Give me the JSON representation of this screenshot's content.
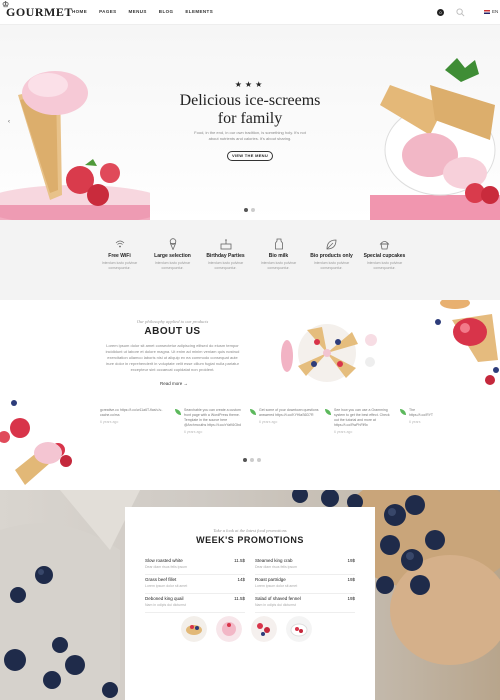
{
  "nav": {
    "logo": "GOURMET",
    "menu": [
      "HOME",
      "PAGES",
      "MENUS",
      "BLOG",
      "ELEMENTS"
    ],
    "cart_count": "0",
    "lang": "EN"
  },
  "hero": {
    "stars": "★★★",
    "title_line1": "Delicious ice-screems",
    "title_line2": "for family",
    "desc": "Food, in the end, in our own tradition, is something holy. It's not about nutrients and calories. It's about sharing.",
    "button": "VIEW THE MENU"
  },
  "features": [
    {
      "title": "Free WiFi",
      "icon": "wifi-icon",
      "desc": "Interdum iusto pulvinar consequuntur."
    },
    {
      "title": "Large selection",
      "icon": "ice-cream-icon",
      "desc": "Interdum iusto pulvinar consequuntur."
    },
    {
      "title": "Birthday Parties",
      "icon": "cake-icon",
      "desc": "Interdum iusto pulvinar consequuntur."
    },
    {
      "title": "Bio milk",
      "icon": "milk-icon",
      "desc": "Interdum iusto pulvinar consequuntur."
    },
    {
      "title": "Bio products only",
      "icon": "leaf-icon",
      "desc": "Interdum iusto pulvinar consequuntur."
    },
    {
      "title": "Special cupcakes",
      "icon": "cupcake-icon",
      "desc": "Interdum iusto pulvinar consequuntur."
    }
  ],
  "about": {
    "subtitle": "Our philosophy applied to our products",
    "title": "ABOUT US",
    "text": "Lorem ipsum dolor sit amet consectetur adipiscing elitsed do eiusm tempor incididunt ut labore et dolore magna. Ut enim ad minim veniam quis nostrud exercitation ullamco laboris nisi ut aliquip ex ea commodo consequat aute irure dolor in reprehenderit in voluptate velit esse cillum fugiat nulla pariatur excepteur sint occaecat cupidatat non proident.",
    "read_more": "Read more →"
  },
  "tweets": [
    {
      "text": "gcreative.co https://t.co/w11a6T-flash-lv-cache.co/rss",
      "time": "6 years ago"
    },
    {
      "text": "Searchable you can create a custom front page with a WordPress theme. Template in the source here @Archmouths https://t.co/xYaK6Gbd",
      "time": "6 years ago"
    },
    {
      "text": "Get some of your downtown questions answered https://t.co/KYHlaS6D7R",
      "time": "6 years ago"
    },
    {
      "text": "See how you can use a Gramming system to get the best effect. Check out the tutorial and more at https://t.co/RwPhFlf9c",
      "time": "6 years ago"
    },
    {
      "text": "The https://t.co/RYT",
      "time": "6 years"
    }
  ],
  "promo": {
    "subtitle": "Take a look at the latest food promotions",
    "title": "WEEK'S PROMOTIONS",
    "left": [
      {
        "name": "Slow roasted white",
        "desc": "Dear diam risus felis ipsum",
        "price": "11.5$"
      },
      {
        "name": "Grass beef fillet",
        "desc": "Lorem ipsum dolor sit amet",
        "price": "14$"
      },
      {
        "name": "Deboned king quail",
        "desc": "Nam in odipis dui dictumst",
        "price": "11.5$"
      }
    ],
    "right": [
      {
        "name": "Steamed king crab",
        "desc": "Dear diam risus felis ipsum",
        "price": "19$"
      },
      {
        "name": "Roast partridge",
        "desc": "Lorem ipsum dolor sit amet",
        "price": "19$"
      },
      {
        "name": "Salad of shaved fennel",
        "desc": "Nam in odipis dui dictumst",
        "price": "19$"
      }
    ]
  }
}
